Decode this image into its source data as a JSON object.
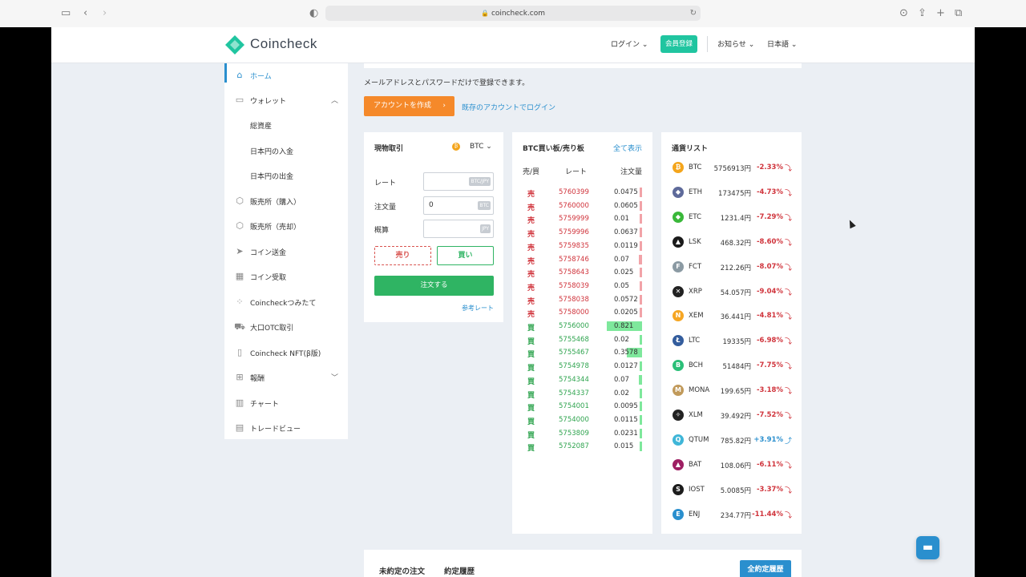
{
  "browser": {
    "url": "coincheck.com"
  },
  "header": {
    "brand": "Coincheck",
    "login": "ログイン",
    "signup": "会員登録",
    "news": "お知らせ",
    "language": "日本語"
  },
  "sidebar": {
    "items": [
      {
        "label": "ホーム",
        "icon": "home-icon"
      },
      {
        "label": "ウォレット",
        "icon": "wallet-icon"
      },
      {
        "label": "総資産"
      },
      {
        "label": "日本円の入金"
      },
      {
        "label": "日本円の出金"
      },
      {
        "label": "販売所（購入）",
        "icon": "box-icon"
      },
      {
        "label": "販売所（売却）",
        "icon": "box-icon"
      },
      {
        "label": "コイン送金",
        "icon": "send-icon"
      },
      {
        "label": "コイン受取",
        "icon": "qr-icon"
      },
      {
        "label": "Coincheckつみたて",
        "icon": "stack-icon"
      },
      {
        "label": "大口OTC取引",
        "icon": "truck-icon"
      },
      {
        "label": "Coincheck NFT(β版)",
        "icon": "nft-icon"
      },
      {
        "label": "報酬",
        "icon": "gift-icon"
      },
      {
        "label": "チャート",
        "icon": "chart-icon"
      },
      {
        "label": "トレードビュー",
        "icon": "tradeview-icon"
      }
    ]
  },
  "intro": {
    "text": "メールアドレスとパスワードだけで登録できます。",
    "create_account": "アカウントを作成",
    "login_existing": "既存のアカウントでログイン"
  },
  "spot": {
    "title": "現物取引",
    "pair": "BTC",
    "rate_label": "レート",
    "rate_unit": "BTC/JPY",
    "amount_label": "注文量",
    "amount_value": "0",
    "amount_unit": "BTC",
    "estimate_label": "概算",
    "estimate_unit": "JPY",
    "sell": "売り",
    "buy": "買い",
    "order": "注文する",
    "ref_rate": "参考レート"
  },
  "book": {
    "title": "BTC買い板/売り板",
    "show_all": "全て表示",
    "col_side": "売/買",
    "col_rate": "レート",
    "col_qty": "注文量",
    "rows": [
      {
        "side": "売",
        "rate": "5760399",
        "qty": "0.0475",
        "depth": 0.05
      },
      {
        "side": "売",
        "rate": "5760000",
        "qty": "0.0605",
        "depth": 0.06
      },
      {
        "side": "売",
        "rate": "5759999",
        "qty": "0.01",
        "depth": 0.02
      },
      {
        "side": "売",
        "rate": "5759996",
        "qty": "0.0637",
        "depth": 0.07
      },
      {
        "side": "売",
        "rate": "5759835",
        "qty": "0.0119",
        "depth": 0.02
      },
      {
        "side": "売",
        "rate": "5758746",
        "qty": "0.07",
        "depth": 0.08
      },
      {
        "side": "売",
        "rate": "5758643",
        "qty": "0.025",
        "depth": 0.03
      },
      {
        "side": "売",
        "rate": "5758039",
        "qty": "0.05",
        "depth": 0.06
      },
      {
        "side": "売",
        "rate": "5758038",
        "qty": "0.0572",
        "depth": 0.06
      },
      {
        "side": "売",
        "rate": "5758000",
        "qty": "0.0205",
        "depth": 0.03
      },
      {
        "side": "買",
        "rate": "5756000",
        "qty": "0.821",
        "depth": 1.0
      },
      {
        "side": "買",
        "rate": "5755468",
        "qty": "0.02",
        "depth": 0.03
      },
      {
        "side": "買",
        "rate": "5755467",
        "qty": "0.3578",
        "depth": 0.44
      },
      {
        "side": "買",
        "rate": "5754978",
        "qty": "0.0127",
        "depth": 0.02
      },
      {
        "side": "買",
        "rate": "5754344",
        "qty": "0.07",
        "depth": 0.08
      },
      {
        "side": "買",
        "rate": "5754337",
        "qty": "0.02",
        "depth": 0.03
      },
      {
        "side": "買",
        "rate": "5754001",
        "qty": "0.0095",
        "depth": 0.02
      },
      {
        "side": "買",
        "rate": "5754000",
        "qty": "0.0115",
        "depth": 0.02
      },
      {
        "side": "買",
        "rate": "5753809",
        "qty": "0.0231",
        "depth": 0.03
      },
      {
        "side": "買",
        "rate": "5752087",
        "qty": "0.015",
        "depth": 0.02
      }
    ]
  },
  "coins": {
    "title": "通貨リスト",
    "rows": [
      {
        "sym": "BTC",
        "price": "5756913円",
        "change": "-2.33%",
        "dir": "down",
        "color": "#f4a51c",
        "glyph": "₿"
      },
      {
        "sym": "ETH",
        "price": "173475円",
        "change": "-4.73%",
        "dir": "down",
        "color": "#5e6a9a",
        "glyph": "◆"
      },
      {
        "sym": "ETC",
        "price": "1231.4円",
        "change": "-7.29%",
        "dir": "down",
        "color": "#3ab83a",
        "glyph": "◆"
      },
      {
        "sym": "LSK",
        "price": "468.32円",
        "change": "-8.60%",
        "dir": "down",
        "color": "#1a1a1a",
        "glyph": "▲"
      },
      {
        "sym": "FCT",
        "price": "212.26円",
        "change": "-8.07%",
        "dir": "down",
        "color": "#8b9aa3",
        "glyph": "F"
      },
      {
        "sym": "XRP",
        "price": "54.057円",
        "change": "-9.04%",
        "dir": "down",
        "color": "#222222",
        "glyph": "✕"
      },
      {
        "sym": "XEM",
        "price": "36.441円",
        "change": "-4.81%",
        "dir": "down",
        "color": "#f6a623",
        "glyph": "N"
      },
      {
        "sym": "LTC",
        "price": "19335円",
        "change": "-6.98%",
        "dir": "down",
        "color": "#345d9d",
        "glyph": "Ł"
      },
      {
        "sym": "BCH",
        "price": "51484円",
        "change": "-7.75%",
        "dir": "down",
        "color": "#2bbf78",
        "glyph": "B"
      },
      {
        "sym": "MONA",
        "price": "199.65円",
        "change": "-3.18%",
        "dir": "down",
        "color": "#c19a5b",
        "glyph": "M"
      },
      {
        "sym": "XLM",
        "price": "39.492円",
        "change": "-7.52%",
        "dir": "down",
        "color": "#222222",
        "glyph": "✧"
      },
      {
        "sym": "QTUM",
        "price": "785.82円",
        "change": "+3.91%",
        "dir": "up",
        "color": "#3fb6d8",
        "glyph": "Q"
      },
      {
        "sym": "BAT",
        "price": "108.06円",
        "change": "-6.11%",
        "dir": "down",
        "color": "#9e1f63",
        "glyph": "▲"
      },
      {
        "sym": "IOST",
        "price": "5.0085円",
        "change": "-3.37%",
        "dir": "down",
        "color": "#1c1c1c",
        "glyph": "S"
      },
      {
        "sym": "ENJ",
        "price": "234.77円",
        "change": "-11.44%",
        "dir": "down",
        "color": "#2a8fce",
        "glyph": "E"
      }
    ]
  },
  "orders": {
    "tab_open": "未約定の注文",
    "tab_history": "約定履歴",
    "all_history": "全約定履歴"
  }
}
